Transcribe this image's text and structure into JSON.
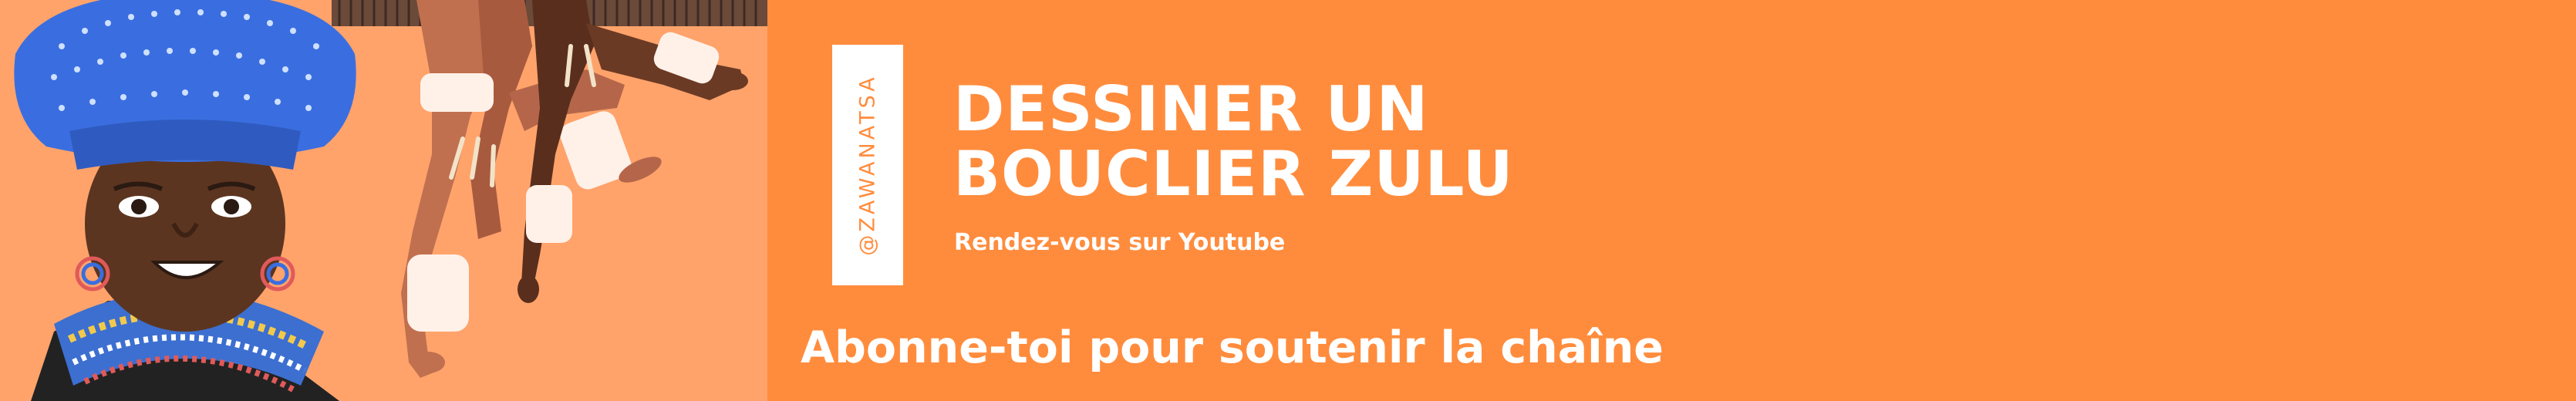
{
  "brand": {
    "handle": "@ZAWANATSA",
    "accent_color": "#ff8c3d",
    "panel_text_color": "#ffffff"
  },
  "headline": {
    "line1": "DESSINER UN",
    "line2": "BOUCLIER ZULU"
  },
  "subtitle": "Rendez-vous sur Youtube",
  "cta": "Abonne-toi pour soutenir la chaîne",
  "illustration": {
    "subject": "zulu-woman-and-dancers",
    "background_color": "#ffa36b"
  }
}
